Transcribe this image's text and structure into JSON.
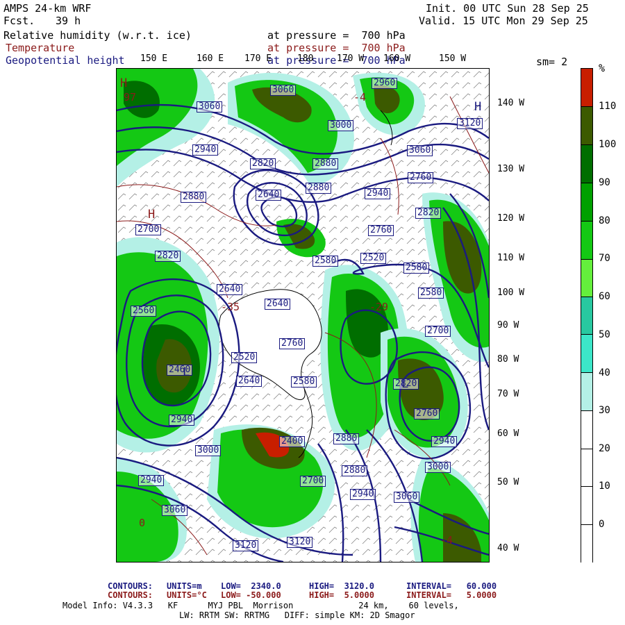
{
  "header": {
    "model_title": "AMPS 24-km WRF",
    "fcst_label": "Fcst.",
    "fcst_value": "39 h",
    "init": "Init. 00 UTC Sun 28 Sep 25",
    "valid": "Valid. 15 UTC Mon 29 Sep 25"
  },
  "fields": [
    {
      "name": "Relative humidity (w.r.t. ice)",
      "level": "at pressure =  700 hPa",
      "color": "#000000"
    },
    {
      "name": "Temperature",
      "level": "at pressure =  700 hPa",
      "color": "#8b1a1a"
    },
    {
      "name": "Geopotential height",
      "level": "at pressure =  700 hPa",
      "color": "#1a1a80"
    }
  ],
  "smoothing": "sm= 2",
  "lon_labels": [
    "150 E",
    "160 E",
    "170 E",
    "180",
    "170 W",
    "160 W",
    "150 W"
  ],
  "lat_labels": [
    "140 W",
    "130 W",
    "120 W",
    "110 W",
    "100 W",
    "90 W",
    "80 W",
    "70 W",
    "60 W",
    "50 W",
    "40 W"
  ],
  "colorbar": {
    "unit": "%",
    "ticks": [
      "110",
      "100",
      "90",
      "80",
      "70",
      "60",
      "50",
      "40",
      "30",
      "20",
      "10",
      "0"
    ],
    "colors": [
      "#c81e00",
      "#3c5a00",
      "#006e00",
      "#00a000",
      "#14c814",
      "#64ef3c",
      "#28c8a0",
      "#3ce6c8",
      "#b4f0e6",
      "#ffffff",
      "#ffffff",
      "#ffffff",
      "#ffffff"
    ]
  },
  "height_labels": [
    "3060",
    "2960",
    "3060",
    "3000",
    "2940",
    "3120",
    "2880",
    "2820",
    "3060",
    "2880",
    "2640",
    "2940",
    "2880",
    "2760",
    "2820",
    "2700",
    "2580",
    "2520",
    "2580",
    "2760",
    "2820",
    "2560",
    "2640",
    "2700",
    "2580",
    "2640",
    "2460",
    "2520",
    "2760",
    "2640",
    "2400",
    "2580",
    "2760",
    "2820",
    "2940",
    "2700",
    "2880",
    "3000",
    "2940",
    "2880",
    "3060",
    "3060",
    "3120",
    "2940",
    "3120",
    "3000",
    "2940"
  ],
  "pressure_centers": [
    {
      "mark": "H",
      "value": "97"
    },
    {
      "mark": "H",
      "value": ""
    },
    {
      "mark": "H",
      "value": ""
    },
    {
      "mark": "L",
      "value": ""
    },
    {
      "mark": "L",
      "value": ""
    }
  ],
  "temp_labels": [
    "-35",
    "-29",
    "-4",
    "0",
    "-4"
  ],
  "footer": {
    "contours1_label": "CONTOURS:",
    "contours1_units": "UNITS=m",
    "contours1_low": "LOW=  2340.0",
    "contours1_high": "HIGH=  3120.0",
    "contours1_interval": "INTERVAL=   60.000",
    "contours2_label": "CONTOURS:",
    "contours2_units": "UNITS=°C",
    "contours2_low": "LOW= -50.000",
    "contours2_high": "HIGH=  5.0000",
    "contours2_interval": "INTERVAL=   5.0000",
    "model_info_1": "Model Info: V4.3.3   KF      MYJ PBL  Morrison             24 km,    60 levels,",
    "model_info_2": "LW: RRTM SW: RRTMG   DIFF: simple KM: 2D Smagor"
  }
}
